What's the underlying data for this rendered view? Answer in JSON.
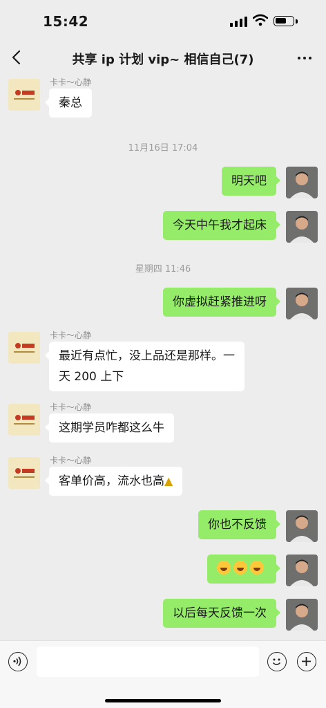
{
  "status": {
    "time": "15:42"
  },
  "nav": {
    "title": "共享 ip 计划 vip~ 相信自己(7)"
  },
  "messages": [
    {
      "id": "m1",
      "direction": "in",
      "sender": "卡卡～心静",
      "lines": [
        "秦总"
      ]
    },
    {
      "id": "t1",
      "timestamp": "11月16日 17:04"
    },
    {
      "id": "m2",
      "direction": "out",
      "lines": [
        "明天吧"
      ]
    },
    {
      "id": "m3",
      "direction": "out",
      "lines": [
        "今天中午我才起床"
      ]
    },
    {
      "id": "t2",
      "timestamp": "星期四 11:46"
    },
    {
      "id": "m4",
      "direction": "out",
      "lines": [
        "你虚拟赶紧推进呀"
      ]
    },
    {
      "id": "m5",
      "direction": "in",
      "sender": "卡卡～心静",
      "lines": [
        "最近有点忙，没上品还是那样。一",
        "天 200 上下"
      ]
    },
    {
      "id": "m6",
      "direction": "in",
      "sender": "卡卡～心静",
      "lines": [
        "这期学员咋都这么牛"
      ]
    },
    {
      "id": "m7",
      "direction": "in",
      "sender": "卡卡～心静",
      "lines": [
        "客单价高，流水也高"
      ],
      "trailing_icon": "thumbs-up-emoji"
    },
    {
      "id": "m8",
      "direction": "out",
      "lines": [
        "你也不反馈"
      ]
    },
    {
      "id": "m9",
      "direction": "out",
      "emojis": [
        "laughing-crying-emoji",
        "laughing-crying-emoji",
        "laughing-crying-emoji"
      ]
    },
    {
      "id": "m10",
      "direction": "out",
      "lines": [
        "以后每天反馈一次"
      ]
    }
  ],
  "input": {
    "placeholder": ""
  },
  "colors": {
    "background": "#ededed",
    "outgoing_bubble": "#95ec69",
    "incoming_bubble": "#ffffff"
  },
  "icons": {
    "back": "chevron-left-icon",
    "more": "more-dots-icon",
    "voice": "voice-icon",
    "emoji": "smiley-icon",
    "plus": "plus-icon"
  }
}
